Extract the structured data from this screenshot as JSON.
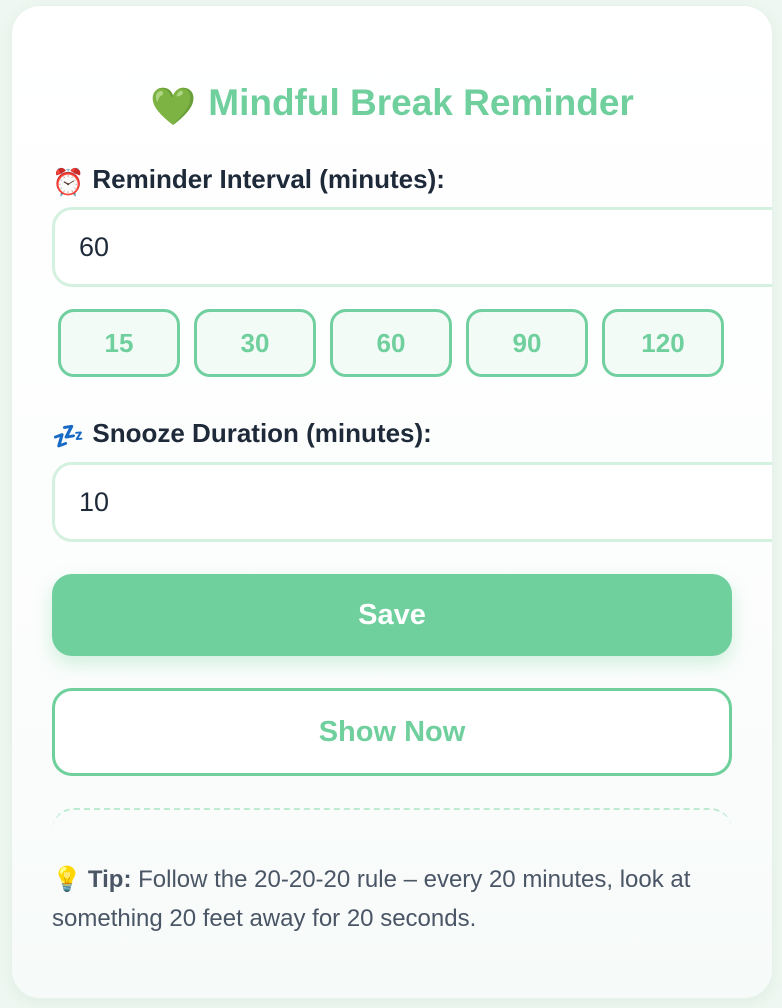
{
  "header": {
    "icon": "green-heart-icon",
    "icon_glyph": "💚",
    "title": "Mindful Break Reminder"
  },
  "interval": {
    "icon": "alarm-clock-icon",
    "icon_glyph": "⏰",
    "label": "Reminder Interval (minutes):",
    "value": "60",
    "presets": [
      "15",
      "30",
      "60",
      "90",
      "120"
    ]
  },
  "snooze": {
    "icon": "zzz-icon",
    "icon_glyph": "💤",
    "label": "Snooze Duration (minutes):",
    "value": "10"
  },
  "actions": {
    "save_label": "Save",
    "show_now_label": "Show Now"
  },
  "tip": {
    "icon": "light-bulb-icon",
    "icon_glyph": "💡",
    "label": "Tip:",
    "text": " Follow the 20-20-20 rule – every 20 minutes, look at something 20 feet away for 20 seconds."
  },
  "colors": {
    "accent": "#6fcf9d",
    "input_border": "#d4f1df",
    "text_dark": "#1e2a3a",
    "text_muted": "#4a5566"
  }
}
